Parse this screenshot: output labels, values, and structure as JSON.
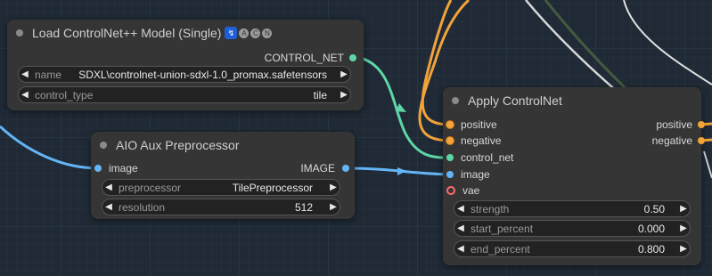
{
  "nodes": {
    "load_cn": {
      "title": "Load ControlNet++ Model (Single)",
      "badges": [
        "↯",
        "A",
        "C",
        "N"
      ],
      "output_label": "CONTROL_NET",
      "widgets": [
        {
          "name": "name",
          "value": "SDXL\\controlnet-union-sdxl-1.0_promax.safetensors"
        },
        {
          "name": "control_type",
          "value": "tile"
        }
      ]
    },
    "aio": {
      "title": "AIO Aux Preprocessor",
      "input_label": "image",
      "output_label": "IMAGE",
      "widgets": [
        {
          "name": "preprocessor",
          "value": "TilePreprocessor"
        },
        {
          "name": "resolution",
          "value": "512"
        }
      ]
    },
    "apply_cn": {
      "title": "Apply ControlNet",
      "inputs": [
        "positive",
        "negative",
        "control_net",
        "image",
        "vae"
      ],
      "outputs": [
        "positive",
        "negative"
      ],
      "widgets": [
        {
          "name": "strength",
          "value": "0.50"
        },
        {
          "name": "start_percent",
          "value": "0.000"
        },
        {
          "name": "end_percent",
          "value": "0.800"
        }
      ]
    }
  },
  "arrows": {
    "left": "◀",
    "right": "▶"
  },
  "colors": {
    "background": "#1f2a36",
    "node": "#353535",
    "conditioning": "#f2a33a",
    "control_net": "#5fd6a8",
    "image": "#64b5f6",
    "vae": "#ff6e6e"
  }
}
